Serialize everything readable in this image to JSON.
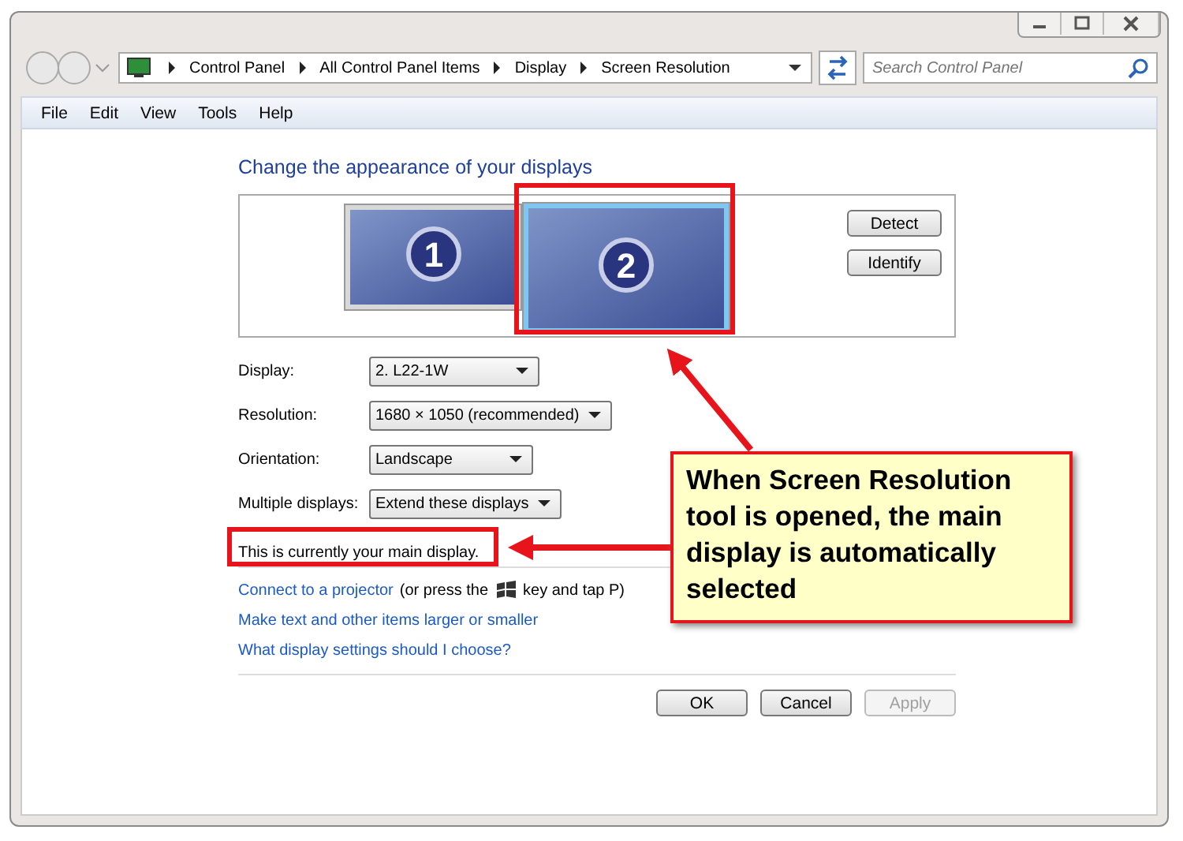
{
  "address_bar": {
    "breadcrumbs": [
      "Control Panel",
      "All Control Panel Items",
      "Display",
      "Screen Resolution"
    ]
  },
  "search": {
    "placeholder": "Search Control Panel"
  },
  "menu": [
    "File",
    "Edit",
    "View",
    "Tools",
    "Help"
  ],
  "heading": "Change the appearance of your displays",
  "monitors": [
    {
      "number": "1",
      "selected": false
    },
    {
      "number": "2",
      "selected": true
    }
  ],
  "side_buttons": [
    "Detect",
    "Identify"
  ],
  "settings": [
    {
      "label": "Display:",
      "value": "2. L22-1W"
    },
    {
      "label": "Resolution:",
      "value": "1680 × 1050 (recommended)"
    },
    {
      "label": "Orientation:",
      "value": "Landscape"
    },
    {
      "label": "Multiple displays:",
      "value": "Extend these displays"
    }
  ],
  "main_display_note": "This is currently your main display.",
  "projector": {
    "link": "Connect to a projector",
    "before_key": "(or press the",
    "after_key": "key and tap P)"
  },
  "links": [
    "Make text and other items larger or smaller",
    "What display settings should I choose?"
  ],
  "footer_buttons": [
    {
      "label": "OK",
      "disabled": false
    },
    {
      "label": "Cancel",
      "disabled": false
    },
    {
      "label": "Apply",
      "disabled": true
    }
  ],
  "annotation": "When Screen Resolution tool is opened, the main display is automatically selected"
}
